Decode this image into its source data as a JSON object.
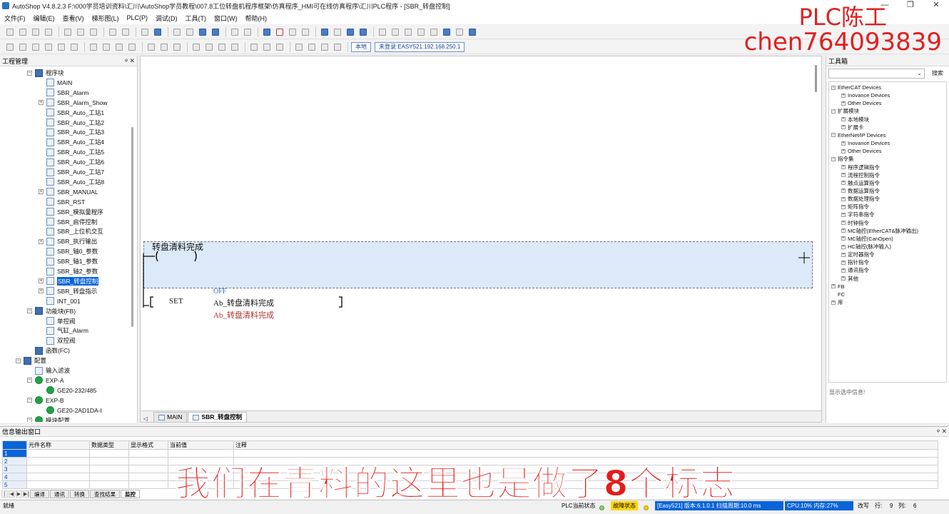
{
  "window": {
    "title": "AutoShop V4.8.2.3  F:\\000学员培训资料\\汇川\\AutoShop学员教程\\007.8工位转盘机程序框架\\仿真程序_HMI可在线仿真程序\\汇川PLC程序 - [SBR_转盘控制]",
    "controls": [
      "—",
      "❐",
      "✕"
    ]
  },
  "menu": [
    "文件(F)",
    "编辑(E)",
    "查看(V)",
    "梯形图(L)",
    "PLC(P)",
    "调试(D)",
    "工具(T)",
    "窗口(W)",
    "帮助(H)"
  ],
  "toolbar": {
    "mode_local": "本地",
    "login_status": "未登录:EASY521:192.168.250.1"
  },
  "watermark": {
    "line1": "PLC陈工",
    "line2": "chen764093839"
  },
  "project": {
    "header": "工程管理",
    "pins": "ᵠ ✕",
    "tree": [
      {
        "label": "程序块",
        "level": 1,
        "exp": "⊟",
        "icon": "folder"
      },
      {
        "label": "MAIN",
        "level": 2,
        "exp": "",
        "icon": "file"
      },
      {
        "label": "SBR_Alarm",
        "level": 2,
        "exp": "",
        "icon": "file"
      },
      {
        "label": "SBR_Alarm_Show",
        "level": 2,
        "exp": "⊞",
        "icon": "file"
      },
      {
        "label": "SBR_Auto_工站1",
        "level": 2,
        "exp": "",
        "icon": "file"
      },
      {
        "label": "SBR_Auto_工站2",
        "level": 2,
        "exp": "",
        "icon": "file"
      },
      {
        "label": "SBR_Auto_工站3",
        "level": 2,
        "exp": "",
        "icon": "file"
      },
      {
        "label": "SBR_Auto_工站4",
        "level": 2,
        "exp": "",
        "icon": "file"
      },
      {
        "label": "SBR_Auto_工站5",
        "level": 2,
        "exp": "",
        "icon": "file"
      },
      {
        "label": "SBR_Auto_工站6",
        "level": 2,
        "exp": "",
        "icon": "file"
      },
      {
        "label": "SBR_Auto_工站7",
        "level": 2,
        "exp": "",
        "icon": "file"
      },
      {
        "label": "SBR_Auto_工站8",
        "level": 2,
        "exp": "",
        "icon": "file"
      },
      {
        "label": "SBR_MANUAL",
        "level": 2,
        "exp": "⊞",
        "icon": "file"
      },
      {
        "label": "SBR_RST",
        "level": 2,
        "exp": "",
        "icon": "file"
      },
      {
        "label": "SBR_模拟量程序",
        "level": 2,
        "exp": "",
        "icon": "file"
      },
      {
        "label": "SBR_启停控制",
        "level": 2,
        "exp": "",
        "icon": "file"
      },
      {
        "label": "SBR_上位机交互",
        "level": 2,
        "exp": "",
        "icon": "file"
      },
      {
        "label": "SBR_执行输出",
        "level": 2,
        "exp": "⊞",
        "icon": "file"
      },
      {
        "label": "SBR_轴0_参数",
        "level": 2,
        "exp": "",
        "icon": "file"
      },
      {
        "label": "SBR_轴1_参数",
        "level": 2,
        "exp": "",
        "icon": "file"
      },
      {
        "label": "SBR_轴2_参数",
        "level": 2,
        "exp": "",
        "icon": "file"
      },
      {
        "label": "SBR_转盘控制",
        "level": 2,
        "exp": "⊞",
        "icon": "file",
        "selected": true
      },
      {
        "label": "SBR_转盘指示",
        "level": 2,
        "exp": "⊞",
        "icon": "file"
      },
      {
        "label": "INT_001",
        "level": 2,
        "exp": "",
        "icon": "file"
      },
      {
        "label": "功能块(FB)",
        "level": 1,
        "exp": "⊟",
        "icon": "folder"
      },
      {
        "label": "单控阀",
        "level": 2,
        "exp": "",
        "icon": "file"
      },
      {
        "label": "气缸_Alarm",
        "level": 2,
        "exp": "",
        "icon": "file"
      },
      {
        "label": "双控阀",
        "level": 2,
        "exp": "",
        "icon": "file"
      },
      {
        "label": "函数(FC)",
        "level": 1,
        "exp": "",
        "icon": "folder"
      },
      {
        "label": "配置",
        "level": 0,
        "exp": "⊟",
        "icon": "folder"
      },
      {
        "label": "输入滤波",
        "level": 1,
        "exp": "",
        "icon": "file"
      },
      {
        "label": "EXP-A",
        "level": 1,
        "exp": "⊟",
        "icon": "ok"
      },
      {
        "label": "GE20-232/485",
        "level": 2,
        "exp": "",
        "icon": "ok"
      },
      {
        "label": "EXP-B",
        "level": 1,
        "exp": "⊟",
        "icon": "ok"
      },
      {
        "label": "GE20-2AD1DA-I",
        "level": 2,
        "exp": "",
        "icon": "ok"
      },
      {
        "label": "模块配置",
        "level": 1,
        "exp": "⊟",
        "icon": "ok"
      }
    ]
  },
  "ladder": {
    "contact_label": "转盘清料完成",
    "instruction": "SET",
    "state": "OFF",
    "operand": "Ab_转盘清料完成",
    "operand_comment": "Ab_转盘清料完成"
  },
  "editor_tabs": [
    {
      "label": "MAIN",
      "active": false
    },
    {
      "label": "SBR_转盘控制",
      "active": true
    }
  ],
  "toolbox": {
    "header": "工具箱",
    "search_button": "搜索",
    "info": "显示选中信息!",
    "tree": [
      {
        "label": "EtherCAT Devices",
        "level": 0,
        "exp": "⊟"
      },
      {
        "label": "Inovance Devices",
        "level": 1,
        "exp": "⊞"
      },
      {
        "label": "Other Devices",
        "level": 1,
        "exp": "⊞"
      },
      {
        "label": "扩展模块",
        "level": 0,
        "exp": "⊟"
      },
      {
        "label": "本地模块",
        "level": 1,
        "exp": "⊞"
      },
      {
        "label": "扩展卡",
        "level": 1,
        "exp": "⊞"
      },
      {
        "label": "EtherNet/IP Devices",
        "level": 0,
        "exp": "⊟"
      },
      {
        "label": "Inovance Devices",
        "level": 1,
        "exp": "⊞"
      },
      {
        "label": "Other Devices",
        "level": 1,
        "exp": "⊞"
      },
      {
        "label": "指令集",
        "level": 0,
        "exp": "⊟"
      },
      {
        "label": "程序逻辑指令",
        "level": 1,
        "exp": "⊞"
      },
      {
        "label": "流程控制指令",
        "level": 1,
        "exp": "⊞"
      },
      {
        "label": "触点运算指令",
        "level": 1,
        "exp": "⊞"
      },
      {
        "label": "数据运算指令",
        "level": 1,
        "exp": "⊞"
      },
      {
        "label": "数据处理指令",
        "level": 1,
        "exp": "⊞"
      },
      {
        "label": "矩阵指令",
        "level": 1,
        "exp": "⊞"
      },
      {
        "label": "字符串指令",
        "level": 1,
        "exp": "⊞"
      },
      {
        "label": "时钟指令",
        "level": 1,
        "exp": "⊞"
      },
      {
        "label": "MC轴控(EtherCAT&脉冲输出)",
        "level": 1,
        "exp": "⊞"
      },
      {
        "label": "MC轴控(CanOpen)",
        "level": 1,
        "exp": "⊞"
      },
      {
        "label": "HC轴控(脉冲输入)",
        "level": 1,
        "exp": "⊞"
      },
      {
        "label": "定时器指令",
        "level": 1,
        "exp": "⊞"
      },
      {
        "label": "指针指令",
        "level": 1,
        "exp": "⊞"
      },
      {
        "label": "通讯指令",
        "level": 1,
        "exp": "⊞"
      },
      {
        "label": "其他",
        "level": 1,
        "exp": "⊞"
      },
      {
        "label": "FB",
        "level": 0,
        "exp": "⊞"
      },
      {
        "label": "FC",
        "level": 0,
        "exp": ""
      },
      {
        "label": "库",
        "level": 0,
        "exp": "⊞"
      }
    ]
  },
  "info_output": {
    "header": "信息输出窗口",
    "pins": "ᵠ ✕",
    "columns": [
      "元件名称",
      "数据类型",
      "显示格式",
      "当前值",
      "注释"
    ],
    "rows": [
      "1",
      "2",
      "3",
      "4",
      "5"
    ],
    "tabs": [
      {
        "label": "编译",
        "active": false
      },
      {
        "label": "通讯",
        "active": false
      },
      {
        "label": "转换",
        "active": false
      },
      {
        "label": "查找结果",
        "active": false
      },
      {
        "label": "监控",
        "active": true
      }
    ]
  },
  "subtitle": "我们在青料的这里也是做了8个标志",
  "status": {
    "ready": "就绪",
    "plc_state_label": "PLC当前状态",
    "fault_label": "故障状态",
    "device_info": "[Easy521] 版本:6.1.0.1 扫描周期:10.0 ms",
    "cpu_info": "CPU:10%  内存:27%",
    "edit_mode": "改写",
    "row_label": "行:",
    "row_value": "9",
    "col_label": "列:",
    "col_value": "6"
  }
}
